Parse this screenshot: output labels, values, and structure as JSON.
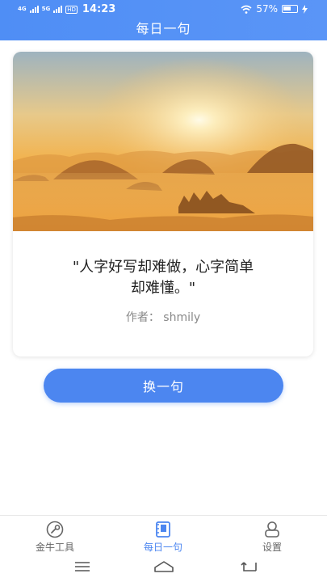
{
  "status_bar": {
    "network_1": "4G",
    "network_2": "5G",
    "hd_badge": "HD",
    "time": "14:23",
    "battery_percent": "57%",
    "battery_level": 0.57
  },
  "header": {
    "title": "每日一句"
  },
  "card": {
    "image_description": "sunrise-over-misty-hills",
    "quote_line1": "\"人字好写却难做，心字简单",
    "quote_line2": "却难懂。\"",
    "author": "作者：  shmily"
  },
  "actions": {
    "next_label": "换一句"
  },
  "tabbar": {
    "items": [
      {
        "label": "金牛工具",
        "icon": "tools-icon",
        "active": false
      },
      {
        "label": "每日一句",
        "icon": "book-icon",
        "active": true
      },
      {
        "label": "设置",
        "icon": "settings-icon",
        "active": false
      }
    ]
  },
  "colors": {
    "primary": "#4c86f0",
    "header": "#5a95f7",
    "text_main": "#222222",
    "text_muted": "#888888"
  }
}
